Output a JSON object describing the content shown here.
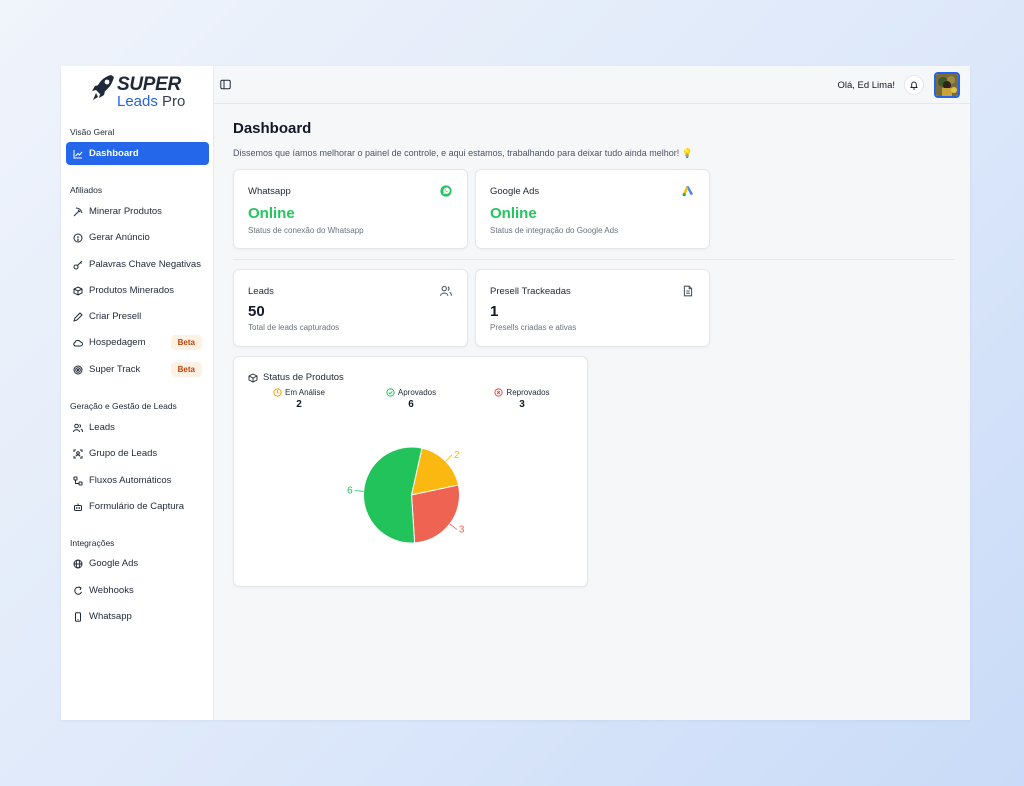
{
  "brand": {
    "word1": "SUPER",
    "word2a": "Leads",
    "word2b": " Pro"
  },
  "sidebar": {
    "sections": [
      {
        "title": "Visão Geral"
      },
      {
        "title": "Afiliados"
      },
      {
        "title": "Geração e Gestão de Leads"
      },
      {
        "title": "Integrações"
      }
    ],
    "items": [
      {
        "label": "Dashboard",
        "icon": "chart-icon"
      },
      {
        "label": "Minerar Produtos",
        "icon": "pickaxe-icon"
      },
      {
        "label": "Gerar Anúncio",
        "icon": "circle-info-icon"
      },
      {
        "label": "Palavras Chave Negativas",
        "icon": "key-icon"
      },
      {
        "label": "Produtos Minerados",
        "icon": "package-icon"
      },
      {
        "label": "Criar Presell",
        "icon": "pen-icon"
      },
      {
        "label": "Hospedagem",
        "icon": "cloud-icon",
        "badge": "Beta"
      },
      {
        "label": "Super Track",
        "icon": "target-icon",
        "badge": "Beta"
      },
      {
        "label": "Leads",
        "icon": "users-icon"
      },
      {
        "label": "Grupo de Leads",
        "icon": "scan-user-icon"
      },
      {
        "label": "Fluxos Automáticos",
        "icon": "workflow-icon"
      },
      {
        "label": "Formulário de Captura",
        "icon": "bot-icon"
      },
      {
        "label": "Google Ads",
        "icon": "globe-icon"
      },
      {
        "label": "Webhooks",
        "icon": "webhook-icon"
      },
      {
        "label": "Whatsapp",
        "icon": "phone-icon"
      }
    ]
  },
  "header": {
    "greeting": "Olá, Ed Lima!"
  },
  "main": {
    "title": "Dashboard",
    "subtitle": "Dissemos que íamos melhorar o painel de controle, e aqui estamos, trabalhando para deixar tudo ainda melhor! 💡",
    "cards": [
      {
        "title": "Whatsapp",
        "value": "Online",
        "desc": "Status de conexão do Whatsapp",
        "icon": "whatsapp-icon"
      },
      {
        "title": "Google Ads",
        "value": "Online",
        "desc": "Status de integração do Google Ads",
        "icon": "google-ads-icon"
      },
      {
        "title": "Leads",
        "value": "50",
        "desc": "Total de leads capturados",
        "icon": "users-icon"
      },
      {
        "title": "Presell Trackeadas",
        "value": "1",
        "desc": "Presells criadas e ativas",
        "icon": "file-icon"
      }
    ],
    "status": {
      "title": "Status de Produtos",
      "stats": [
        {
          "label": "Em Análise",
          "value": "2",
          "color": "#f59e0b"
        },
        {
          "label": "Aprovados",
          "value": "6",
          "color": "#22c55e"
        },
        {
          "label": "Reprovados",
          "value": "3",
          "color": "#ef4444"
        }
      ]
    }
  },
  "chart_data": {
    "type": "pie",
    "categories": [
      "Em Análise",
      "Reprovados",
      "Aprovados"
    ],
    "values": [
      2,
      3,
      6
    ],
    "colors": [
      "#fbb811",
      "#ee6352",
      "#22c35a"
    ],
    "data_labels": [
      "2",
      "3",
      "6"
    ]
  }
}
